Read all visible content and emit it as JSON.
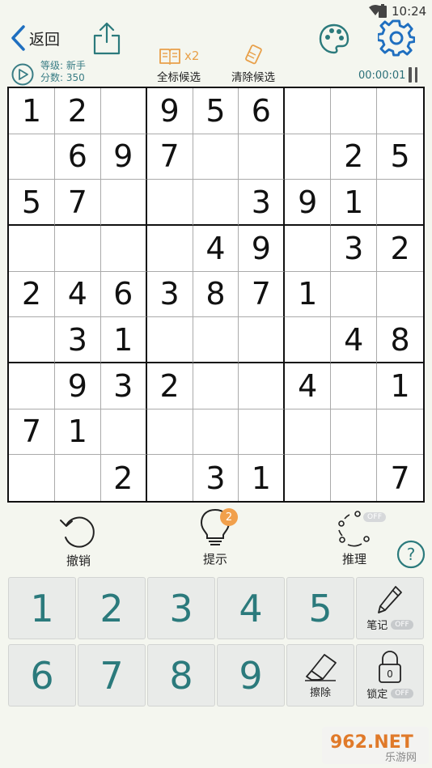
{
  "status_bar": {
    "time": "10:24"
  },
  "header": {
    "back_label": "返回"
  },
  "info": {
    "level": "等级: 新手",
    "score": "分数: 350",
    "notes_multiplier": "x2",
    "all_notes_label": "全标候选",
    "clear_notes_label": "清除候选",
    "timer": "00:00:01"
  },
  "board": [
    [
      "1",
      "2",
      "",
      "9",
      "5",
      "6",
      "",
      "",
      ""
    ],
    [
      "",
      "6",
      "9",
      "7",
      "",
      "",
      "",
      "2",
      "5"
    ],
    [
      "5",
      "7",
      "",
      "",
      "",
      "3",
      "9",
      "1",
      ""
    ],
    [
      "",
      "",
      "",
      "",
      "4",
      "9",
      "",
      "3",
      "2"
    ],
    [
      "2",
      "4",
      "6",
      "3",
      "8",
      "7",
      "1",
      "",
      ""
    ],
    [
      "",
      "3",
      "1",
      "",
      "",
      "",
      "",
      "4",
      "8"
    ],
    [
      "",
      "9",
      "3",
      "2",
      "",
      "",
      "4",
      "",
      "1"
    ],
    [
      "7",
      "1",
      "",
      "",
      "",
      "",
      "",
      "",
      ""
    ],
    [
      "",
      "",
      "2",
      "",
      "3",
      "1",
      "",
      "",
      "7"
    ]
  ],
  "tools": {
    "undo_label": "撤销",
    "hint_label": "提示",
    "hint_count": "2",
    "infer_label": "推理",
    "infer_state": "OFF"
  },
  "keypad": {
    "digits": [
      "1",
      "2",
      "3",
      "4",
      "5",
      "6",
      "7",
      "8",
      "9"
    ],
    "notes_label": "笔记",
    "notes_state": "OFF",
    "erase_label": "擦除",
    "lock_label": "锁定",
    "lock_state": "OFF",
    "lock_digit": "0"
  },
  "watermark": {
    "brand": "962.NET",
    "sub": "乐游网"
  },
  "colors": {
    "accent": "#2b7a7c",
    "icon_blue": "#1f6fc0",
    "hint_badge": "#f1a04c",
    "background": "#f4f6ef"
  }
}
